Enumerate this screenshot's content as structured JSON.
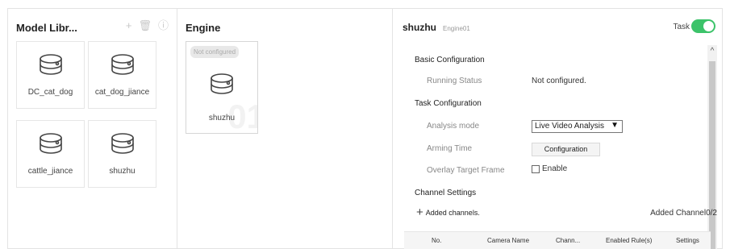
{
  "model_library": {
    "title": "Model Libr...",
    "tools": [
      {
        "icon": "plus-icon",
        "glyph": "+"
      },
      {
        "icon": "trash-icon",
        "glyph": "🗑"
      },
      {
        "icon": "info-icon",
        "glyph": "ⓘ"
      }
    ],
    "models": [
      "DC_cat_dog",
      "cat_dog_jiance",
      "cattle_jiance",
      "shuzhu"
    ]
  },
  "engine": {
    "title": "Engine",
    "card": {
      "badge": "Not configured",
      "name": "shuzhu",
      "watermark": "01"
    }
  },
  "config": {
    "title": "shuzhu",
    "subtitle": "Engine01",
    "task_label": "Task",
    "task_enabled": true,
    "basic_section": "Basic Configuration",
    "running_status_label": "Running Status",
    "running_status_value": "Not configured.",
    "task_section": "Task Configuration",
    "analysis_mode_label": "Analysis mode",
    "analysis_mode_value": "Live Video Analysis",
    "arming_time_label": "Arming Time",
    "configuration_button": "Configuration",
    "overlay_label": "Overlay Target Frame",
    "enable_label": "Enable",
    "channel_section": "Channel Settings",
    "added_channels_label": "Added channels.",
    "added_channel_count": "Added Channel0/2",
    "table_headers": [
      "No.",
      "Camera Name",
      "Chann...",
      "Enabled Rule(s)",
      "Settings"
    ]
  },
  "colors": {
    "toggle_on": "#3cc36a",
    "border": "#e3e3e3"
  }
}
